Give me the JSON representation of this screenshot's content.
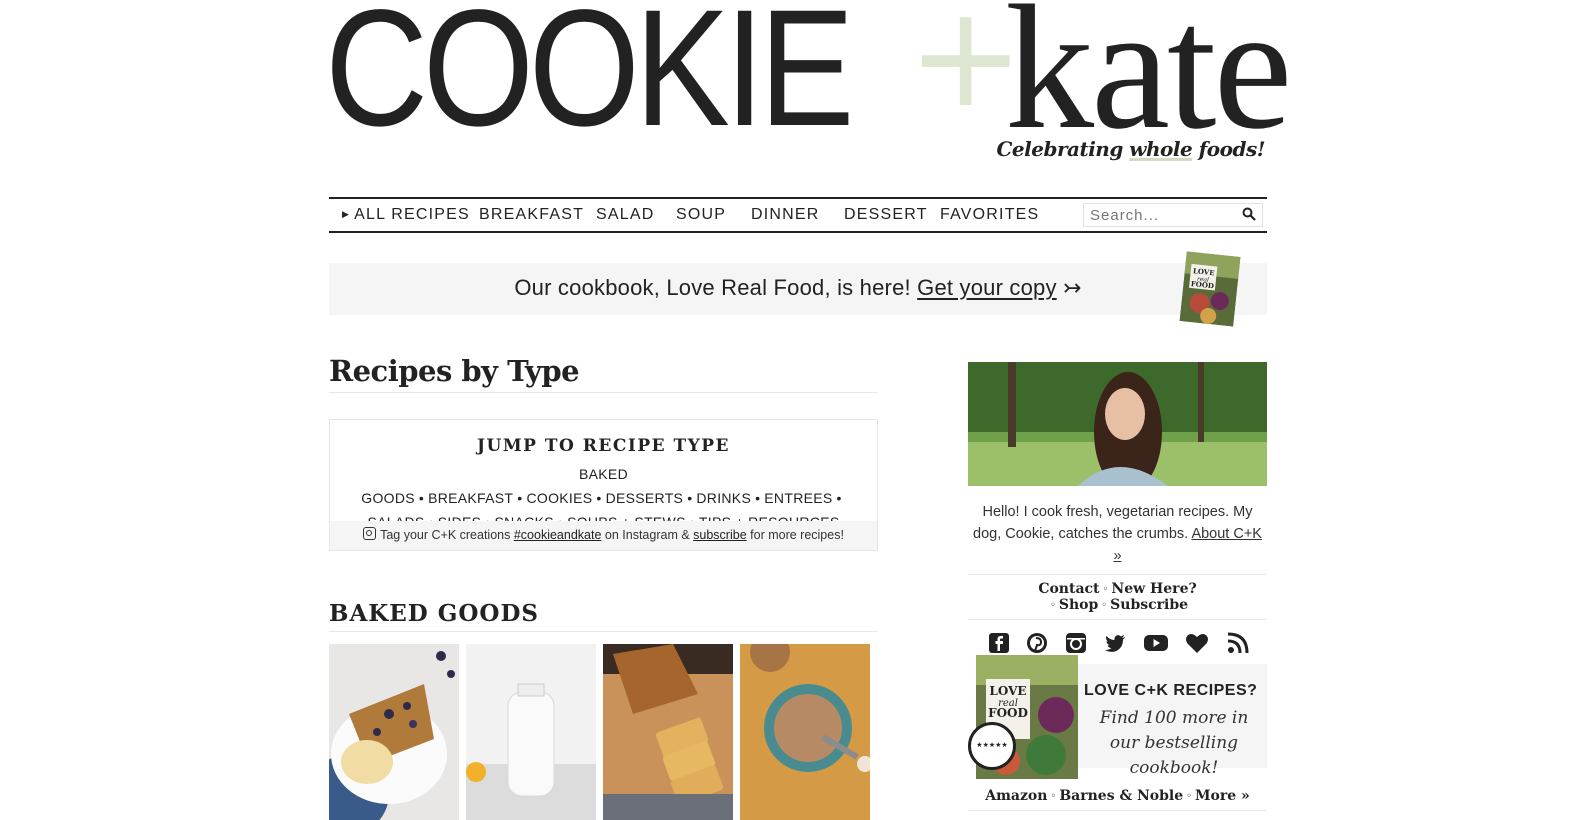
{
  "logo": {
    "cookie": "COOKIE",
    "plus": "+",
    "kate": "kate",
    "tagline_pre": "Celebrating ",
    "tagline_hl": "whole",
    "tagline_post": " foods!"
  },
  "nav": {
    "items": [
      "ALL RECIPES",
      "BREAKFAST",
      "SALAD",
      "SOUP",
      "DINNER",
      "DESSERT",
      "FAVORITES"
    ],
    "search_placeholder": "Search..."
  },
  "banner": {
    "text": "Our cookbook, Love Real Food, is here!",
    "link": "Get your copy",
    "arrow": "↣"
  },
  "main": {
    "title": "Recipes by Type",
    "jump_title": "JUMP TO RECIPE TYPE",
    "jump_links": [
      "BAKED GOODS",
      "BREAKFAST",
      "COOKIES",
      "DESSERTS",
      "DRINKS",
      "ENTREES",
      "SALADS",
      "SIDES",
      "SNACKS",
      "SOUPS + STEWS",
      "TIPS + RESOURCES"
    ],
    "foot_pre": "Tag your C+K creations",
    "foot_hashtag": "#cookieandkate",
    "foot_mid": "on Instagram &",
    "foot_subscribe": "subscribe",
    "foot_post": "for more recipes!",
    "section_title": "BAKED GOODS"
  },
  "sidebar": {
    "bio": "Hello! I cook fresh, vegetarian recipes. My dog, Cookie, catches the crumbs.",
    "about_link": "About C+K »",
    "links": [
      "Contact",
      "New Here?",
      "Shop",
      "Subscribe"
    ],
    "social_icons": [
      "facebook-icon",
      "pinterest-icon",
      "instagram-icon",
      "twitter-icon",
      "youtube-icon",
      "heart-icon",
      "rss-icon"
    ],
    "promo_title": "LOVE C+K RECIPES?",
    "promo_sub": "Find 100 more in our bestselling cookbook!",
    "buy_links": [
      "Amazon",
      "Barnes & Noble",
      "More »"
    ],
    "stars": "★★★★★"
  },
  "colors": {
    "accent_green": "#dde6d0",
    "text": "#222222",
    "panel": "#f5f5f5"
  }
}
